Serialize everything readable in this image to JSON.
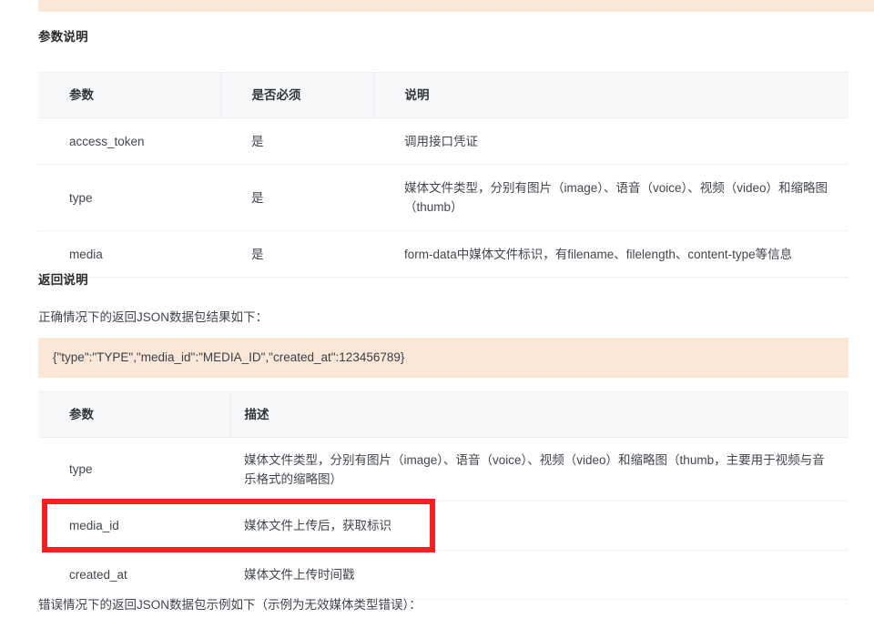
{
  "page": {
    "top_code_band": "",
    "sections": {
      "params_heading": "参数说明",
      "return_heading": "返回说明",
      "return_intro": "正确情况下的返回JSON数据包结果如下：",
      "error_intro": "错误情况下的返回JSON数据包示例如下（示例为无效媒体类型错误）："
    },
    "code_sample": "{\"type\":\"TYPE\",\"media_id\":\"MEDIA_ID\",\"created_at\":123456789}"
  },
  "params_table": {
    "headers": [
      "参数",
      "是否必须",
      "说明"
    ],
    "rows": [
      {
        "param": "access_token",
        "required": "是",
        "desc": "调用接口凭证"
      },
      {
        "param": "type",
        "required": "是",
        "desc": "媒体文件类型，分别有图片（image）、语音（voice）、视频（video）和缩略图（thumb）"
      },
      {
        "param": "media",
        "required": "是",
        "desc": "form-data中媒体文件标识，有filename、filelength、content-type等信息"
      }
    ]
  },
  "return_table": {
    "headers": [
      "参数",
      "描述"
    ],
    "rows": [
      {
        "param": "type",
        "desc": "媒体文件类型，分别有图片（image）、语音（voice）、视频（video）和缩略图（thumb，主要用于视频与音乐格式的缩略图）"
      },
      {
        "param": "media_id",
        "desc": "媒体文件上传后，获取标识"
      },
      {
        "param": "created_at",
        "desc": "媒体文件上传时间戳"
      }
    ]
  },
  "annotation": {
    "highlight_color": "#f22020",
    "highlight_target": "media_id"
  },
  "colors": {
    "code_background": "#fbe7d8",
    "table_header_background": "#f7f8fa",
    "border": "#eceef1",
    "text": "#41464e",
    "heading": "#2b2b2b"
  }
}
